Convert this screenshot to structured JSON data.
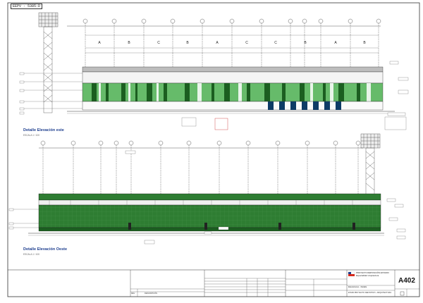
{
  "sheet": {
    "ref_tag": "EEPV - 5385-D",
    "sheet_number": "A402",
    "logo_colors": {
      "red": "#d52b1e",
      "blue": "#1f3f8f",
      "white": "#ffffff"
    }
  },
  "drawings": [
    {
      "title": "Detalle Elevación este",
      "scale": "ESCALA 1 / 100"
    },
    {
      "title": "Detalle Elevación Oeste",
      "scale": "ESCALA 1 / 100"
    }
  ],
  "east_elevation": {
    "bay_letters": [
      "A",
      "B",
      "C",
      "B",
      "A",
      "C",
      "C",
      "B",
      "A",
      "B"
    ]
  },
  "title_block": {
    "column_headers": [
      "REV",
      "DESCRIPCIÓN"
    ],
    "project_lines": [
      "PROYECTO REPOSICIÓN ESTADIO",
      "Especialidad: Arquitectura",
      "Elevaciones - Detalle"
    ],
    "footer_line": "ETAPA PROYECTO DEFINITIVO - ARQUITECTURA"
  },
  "colors": {
    "line": "#333333",
    "roof_green": "#2e7d32",
    "dark_green": "#1b5e20",
    "light_green": "#a5d6a7",
    "blue_panel": "#0d3b66",
    "annotation_red": "#c62828"
  }
}
